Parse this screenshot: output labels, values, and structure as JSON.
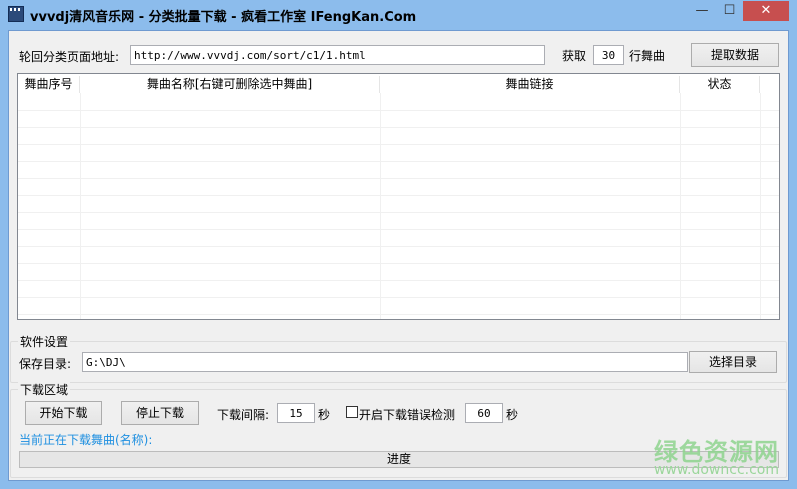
{
  "window": {
    "title": "vvvdj清风音乐网 - 分类批量下载 - 疯看工作室 IFengKan.Com",
    "minimize": "—",
    "maximize": "☐",
    "close": "✕"
  },
  "top": {
    "url_label": "轮回分类页面地址:",
    "url_value": "http://www.vvvdj.com/sort/c1/1.html",
    "fetch_label": "获取",
    "fetch_count": "30",
    "rows_label": "行舞曲",
    "extract_button": "提取数据"
  },
  "table": {
    "columns": [
      "舞曲序号",
      "舞曲名称[右键可删除选中舞曲]",
      "舞曲链接",
      "状态"
    ],
    "rows": []
  },
  "settings": {
    "group_label": "软件设置",
    "save_dir_label": "保存目录:",
    "save_dir_value": "G:\\DJ\\",
    "choose_dir_button": "选择目录"
  },
  "download": {
    "group_label": "下载区域",
    "start_button": "开始下载",
    "stop_button": "停止下载",
    "interval_label": "下载间隔:",
    "interval_value": "15",
    "sec1": "秒",
    "error_check_label": "开启下载错误检测",
    "error_check_checked": false,
    "error_value": "60",
    "sec2": "秒",
    "current_label": "当前正在下载舞曲(名称):",
    "progress_label": "进度",
    "progress": 0
  },
  "watermark": {
    "text": "绿色资源网",
    "url": "www.downcc.com"
  }
}
